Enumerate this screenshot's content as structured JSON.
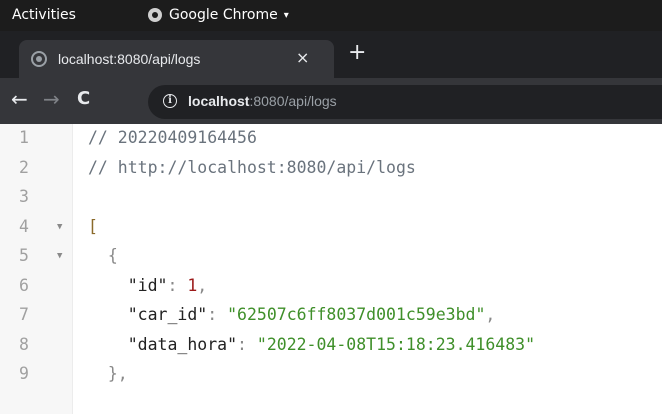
{
  "topbar": {
    "activities": "Activities",
    "app_name": "Google Chrome",
    "app_caret": "▾"
  },
  "tab": {
    "title": "localhost:8080/api/logs",
    "close": "×",
    "new_tab": "+"
  },
  "toolbar": {
    "back": "←",
    "forward": "→",
    "reload": "C",
    "info": "i",
    "url_host": "localhost",
    "url_rest": ":8080/api/logs"
  },
  "code": {
    "lines": [
      {
        "n": "1",
        "fold": "",
        "parts": [
          [
            "c-comment",
            "// 20220409164456"
          ]
        ]
      },
      {
        "n": "2",
        "fold": "",
        "parts": [
          [
            "c-comment",
            "// http://localhost:8080/api/logs"
          ]
        ]
      },
      {
        "n": "3",
        "fold": "",
        "parts": []
      },
      {
        "n": "4",
        "fold": "▼",
        "parts": [
          [
            "c-delim",
            "["
          ]
        ]
      },
      {
        "n": "5",
        "fold": "▼",
        "parts": [
          [
            "c-punct",
            "  {"
          ]
        ]
      },
      {
        "n": "6",
        "fold": "",
        "parts": [
          [
            "c-key",
            "    \"id\""
          ],
          [
            "c-punct",
            ": "
          ],
          [
            "c-num",
            "1"
          ],
          [
            "c-punct",
            ","
          ]
        ]
      },
      {
        "n": "7",
        "fold": "",
        "parts": [
          [
            "c-key",
            "    \"car_id\""
          ],
          [
            "c-punct",
            ": "
          ],
          [
            "c-str",
            "\"62507c6ff8037d001c59e3bd\""
          ],
          [
            "c-punct",
            ","
          ]
        ]
      },
      {
        "n": "8",
        "fold": "",
        "parts": [
          [
            "c-key",
            "    \"data_hora\""
          ],
          [
            "c-punct",
            ": "
          ],
          [
            "c-str",
            "\"2022-04-08T15:18:23.416483\""
          ]
        ]
      },
      {
        "n": "9",
        "fold": "",
        "parts": [
          [
            "c-punct",
            "  },"
          ]
        ]
      }
    ]
  }
}
